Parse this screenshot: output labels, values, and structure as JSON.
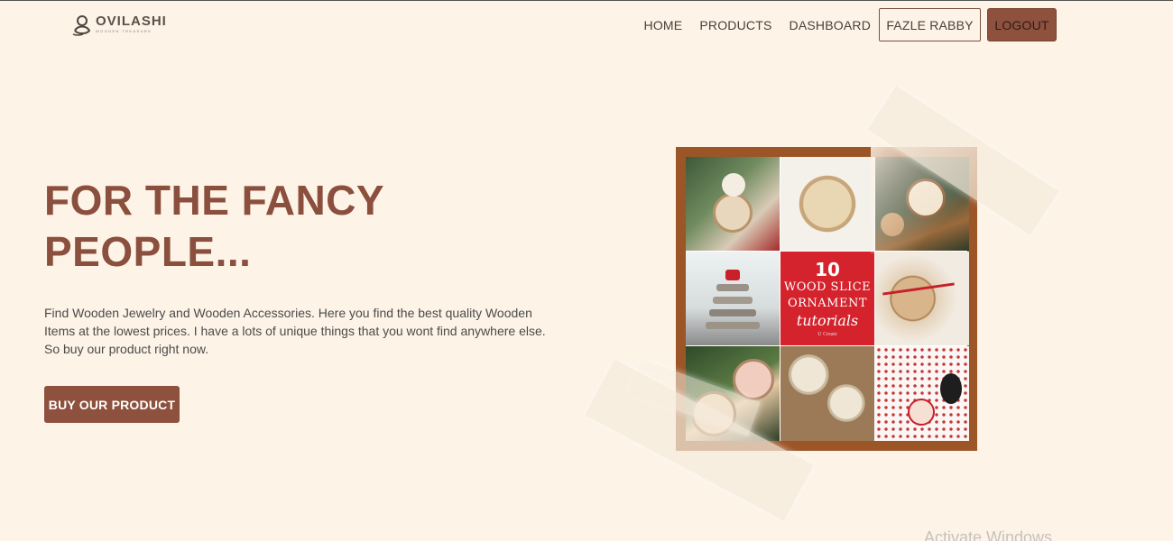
{
  "brand": {
    "name": "OVILASHI",
    "tagline": "WOODEN TREASURE"
  },
  "nav": {
    "links": [
      "HOME",
      "PRODUCTS",
      "DASHBOARD"
    ],
    "user_label": "FAZLE RABBY",
    "logout_label": "LOGOUT"
  },
  "hero": {
    "title": "FOR THE FANCY PEOPLE...",
    "description": "Find Wooden Jewelry and Wooden Accessories. Here you find the best quality Wooden Items at the lowest prices. I have a lots of unique things that you wont find anywhere else. So buy our product right now.",
    "cta_label": "BUY OUR PRODUCT"
  },
  "image": {
    "poster": {
      "number": "10",
      "line1": "WOOD SLICE",
      "line2": "ORNAMENT",
      "line3": "tutorials",
      "credit": "U Create"
    }
  },
  "system": {
    "watermark": "Activate Windows"
  },
  "colors": {
    "background": "#fdf3e7",
    "accent": "#8d513e",
    "title": "#8a4f3d",
    "frame": "#9b5527",
    "poster_red": "#d4232d"
  }
}
